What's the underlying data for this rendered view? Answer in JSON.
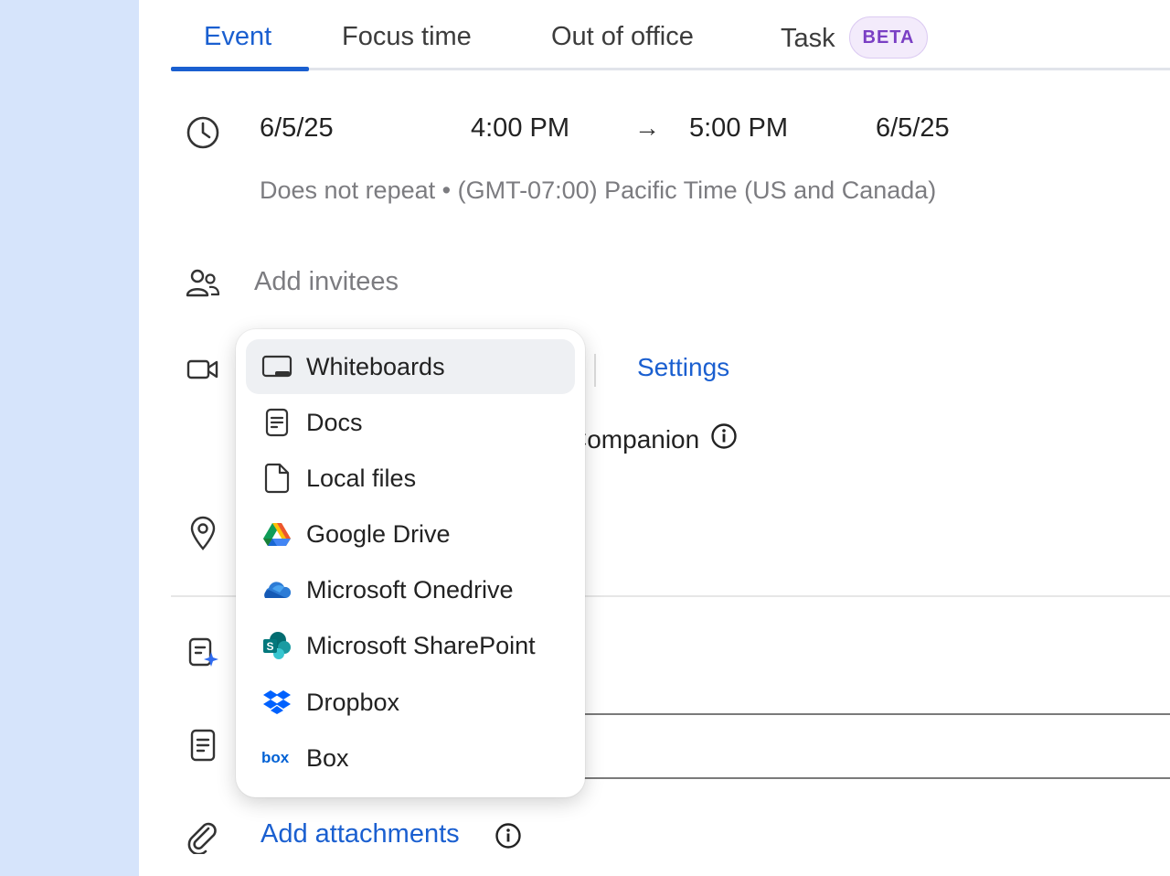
{
  "tabs": [
    {
      "label": "Event",
      "active": true
    },
    {
      "label": "Focus time",
      "active": false
    },
    {
      "label": "Out of office",
      "active": false
    },
    {
      "label": "Task",
      "active": false
    }
  ],
  "task_badge": "BETA",
  "time": {
    "start_date": "6/5/25",
    "start_time": "4:00 PM",
    "arrow": "→",
    "end_time": "5:00 PM",
    "end_date": "6/5/25",
    "repeat_timezone": "Does not repeat • (GMT-07:00) Pacific Time (US and Canada)"
  },
  "invitees": {
    "placeholder": "Add invitees"
  },
  "video": {
    "settings_label": "Settings",
    "companion_text": "Companion"
  },
  "attachments": {
    "label": "Add attachments"
  },
  "menu": {
    "items": [
      {
        "label": "Whiteboards",
        "icon": "whiteboard-icon",
        "highlighted": true
      },
      {
        "label": "Docs",
        "icon": "docs-icon",
        "highlighted": false
      },
      {
        "label": "Local files",
        "icon": "file-icon",
        "highlighted": false
      },
      {
        "label": "Google Drive",
        "icon": "google-drive-icon",
        "highlighted": false
      },
      {
        "label": "Microsoft Onedrive",
        "icon": "onedrive-icon",
        "highlighted": false
      },
      {
        "label": "Microsoft SharePoint",
        "icon": "sharepoint-icon",
        "highlighted": false
      },
      {
        "label": "Dropbox",
        "icon": "dropbox-icon",
        "highlighted": false
      },
      {
        "label": "Box",
        "icon": "box-icon",
        "highlighted": false
      }
    ]
  },
  "colors": {
    "accent": "#1a5fd0",
    "rail": "#d6e4fb",
    "beta_text": "#7a3fc4",
    "beta_bg": "#f3ebfb"
  }
}
